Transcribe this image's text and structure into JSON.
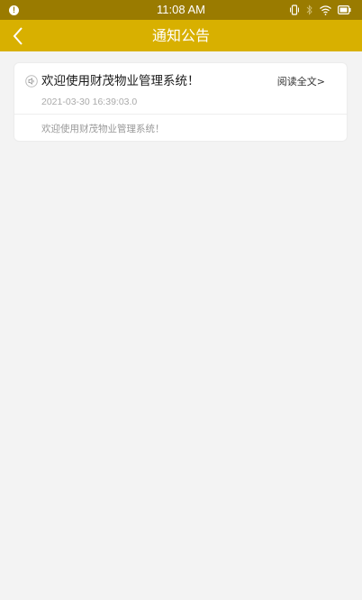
{
  "status_bar": {
    "time": "11:08 AM",
    "alert_glyph": "!",
    "icons": [
      "alert-icon",
      "vibrate-icon",
      "bluetooth-icon",
      "wifi-icon",
      "battery-icon"
    ]
  },
  "header": {
    "title": "通知公告",
    "back_icon": "chevron-left-icon"
  },
  "notices": [
    {
      "icon": "speaker-icon",
      "title": "欢迎使用财茂物业管理系统！",
      "read_more": "阅读全文>",
      "date": "2021-03-30 16:39:03.0",
      "summary": "欢迎使用财茂物业管理系统！"
    }
  ],
  "colors": {
    "status_bar": "#9a7b00",
    "nav_bar": "#d8b000",
    "background": "#f3f3f3",
    "card": "#ffffff"
  }
}
